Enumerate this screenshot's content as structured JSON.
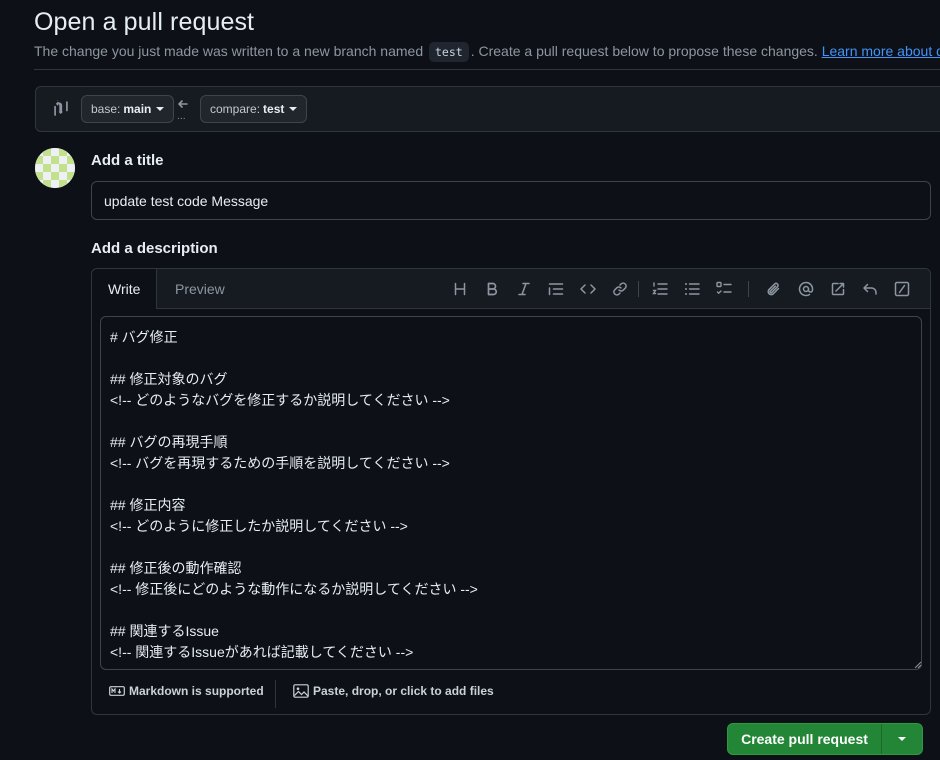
{
  "page": {
    "title": "Open a pull request",
    "subtitle_before": "The change you just made was written to a new branch named",
    "branch_code": "test",
    "subtitle_after": ". Create a pull request below to propose these changes.",
    "learn_more_link": "Learn more about diff"
  },
  "branch_selector": {
    "base_prefix": "base:",
    "base_value": "main",
    "compare_prefix": "compare:",
    "compare_value": "test",
    "ellipsis": "..."
  },
  "form": {
    "title_label": "Add a title",
    "title_value": "update test code Message",
    "description_label": "Add a description"
  },
  "editor": {
    "tabs": [
      "Write",
      "Preview"
    ],
    "active_tab": "Write",
    "toolbar_icons": [
      "heading-icon",
      "bold-icon",
      "italic-icon",
      "quote-icon",
      "code-icon",
      "link-icon",
      "ordered-list-icon",
      "unordered-list-icon",
      "task-list-icon",
      "attach-icon",
      "mention-icon",
      "reference-icon",
      "undo-icon",
      "slash-command-icon"
    ],
    "body": "# バグ修正\n\n## 修正対象のバグ\n<!-- どのようなバグを修正するか説明してください -->\n\n## バグの再現手順\n<!-- バグを再現するための手順を説明してください -->\n\n## 修正内容\n<!-- どのように修正したか説明してください -->\n\n## 修正後の動作確認\n<!-- 修正後にどのような動作になるか説明してください -->\n\n## 関連するIssue\n<!-- 関連するIssueがあれば記載してください -->",
    "markdown_note": "Markdown is supported",
    "attach_note": "Paste, drop, or click to add files"
  },
  "actions": {
    "submit_label": "Create pull request"
  },
  "colors": {
    "background": "#0d1117",
    "primary_button": "#238636",
    "link": "#4493f8"
  }
}
